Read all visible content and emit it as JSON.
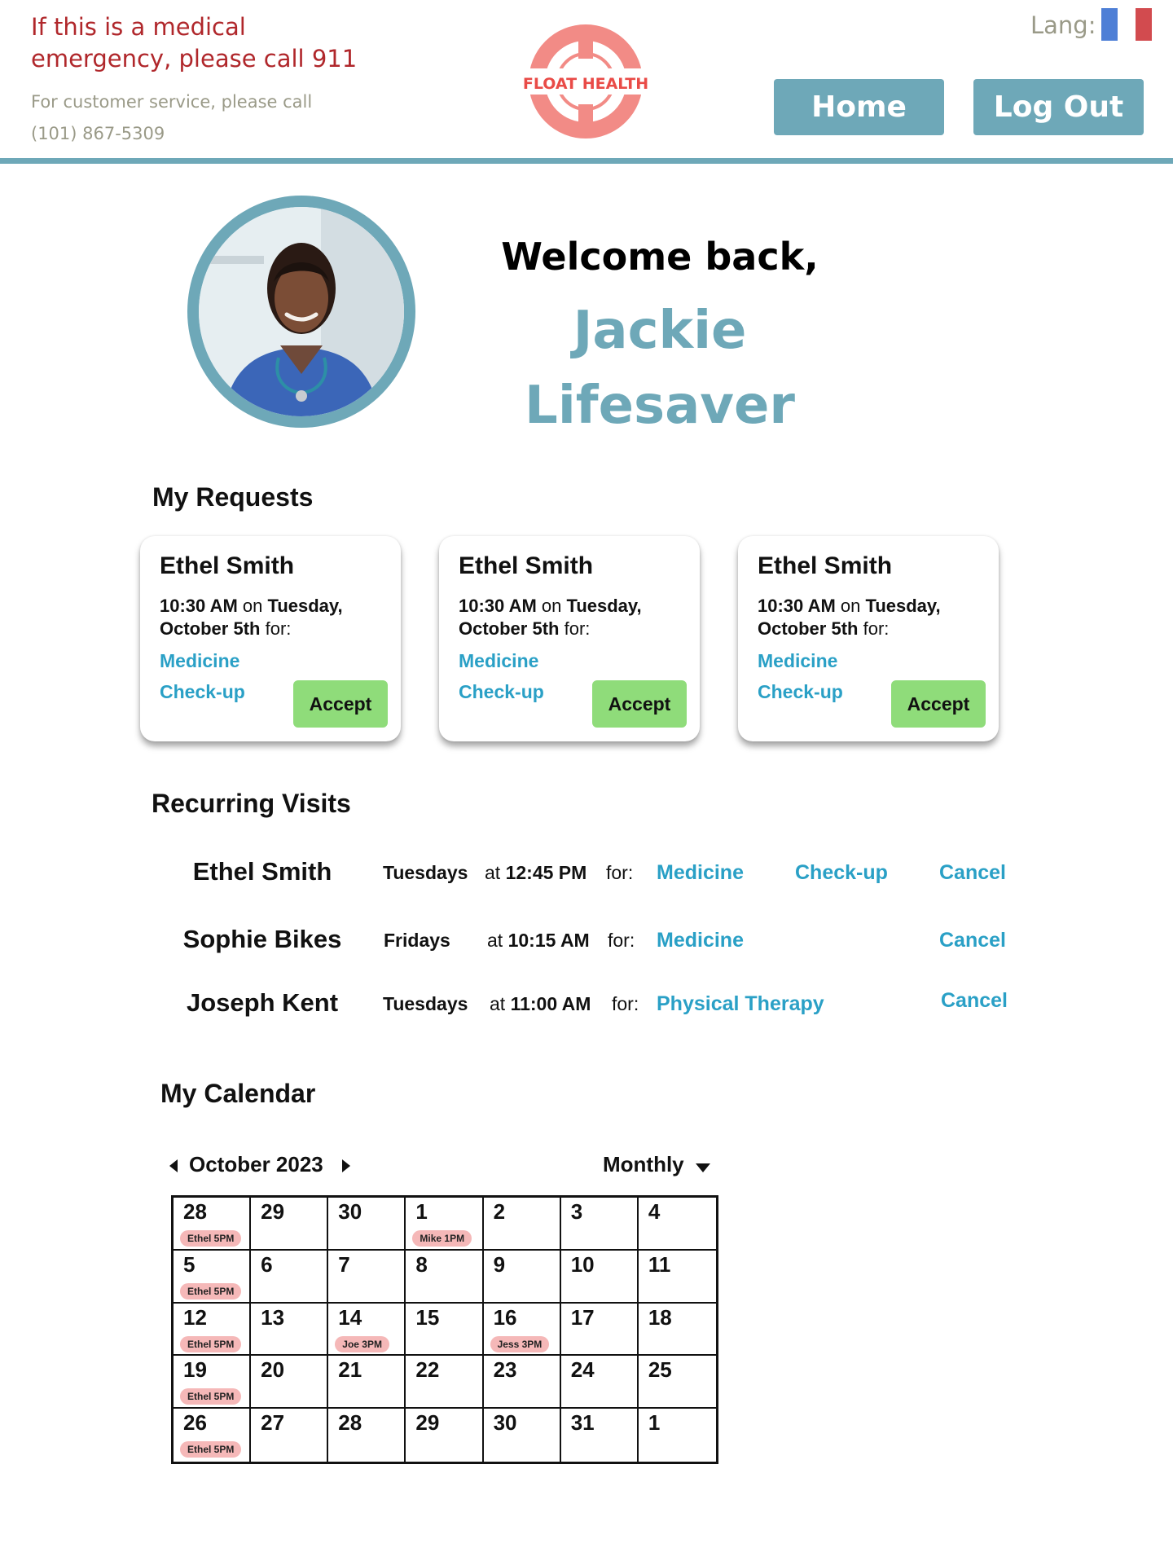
{
  "header": {
    "emergency_text": "If this is a medical emergency, please call 911",
    "service_text": "For customer service, please call (101) 867-5309",
    "logo_text": "FLOAT HEALTH",
    "lang_label": "Lang:",
    "home_label": "Home",
    "logout_label": "Log Out",
    "colors": {
      "accent": "#6ea8b8",
      "emergency": "#b0272b",
      "logo": "#f28b86"
    }
  },
  "profile": {
    "welcome": "Welcome back,",
    "first_name": "Jackie",
    "last_name": "Lifesaver"
  },
  "requests": {
    "title": "My Requests",
    "items": [
      {
        "patient": "Ethel Smith",
        "time": "10:30 AM",
        "on": "on",
        "day": "Tuesday,",
        "date": "October 5th",
        "for": "for:",
        "service1": "Medicine",
        "service2": "Check-up",
        "accept": "Accept"
      },
      {
        "patient": "Ethel Smith",
        "time": "10:30 AM",
        "on": "on",
        "day": "Tuesday,",
        "date": "October 5th",
        "for": "for:",
        "service1": "Medicine",
        "service2": "Check-up",
        "accept": "Accept"
      },
      {
        "patient": "Ethel Smith",
        "time": "10:30 AM",
        "on": "on",
        "day": "Tuesday,",
        "date": "October 5th",
        "for": "for:",
        "service1": "Medicine",
        "service2": "Check-up",
        "accept": "Accept"
      }
    ]
  },
  "recurring": {
    "title": "Recurring Visits",
    "items": [
      {
        "patient": "Ethel Smith",
        "day": "Tuesdays",
        "at": "at",
        "time": "12:45 PM",
        "for": "for:",
        "service1": "Medicine",
        "service2": "Check-up",
        "cancel": "Cancel"
      },
      {
        "patient": "Sophie Bikes",
        "day": "Fridays",
        "at": "at",
        "time": "10:15 AM",
        "for": "for:",
        "service1": "Medicine",
        "service2": "",
        "cancel": "Cancel"
      },
      {
        "patient": "Joseph Kent",
        "day": "Tuesdays",
        "at": "at",
        "time": "11:00 AM",
        "for": "for:",
        "service1": "Physical Therapy",
        "service2": "",
        "cancel": "Cancel"
      }
    ]
  },
  "calendar": {
    "title": "My Calendar",
    "month_label": "October 2023",
    "view_label": "Monthly",
    "event_color": "#f5b8b8",
    "weeks": [
      [
        {
          "day": "28",
          "event": "Ethel 5PM"
        },
        {
          "day": "29",
          "event": ""
        },
        {
          "day": "30",
          "event": ""
        },
        {
          "day": "1",
          "event": "Mike 1PM"
        },
        {
          "day": "2",
          "event": ""
        },
        {
          "day": "3",
          "event": ""
        },
        {
          "day": "4",
          "event": ""
        }
      ],
      [
        {
          "day": "5",
          "event": "Ethel 5PM"
        },
        {
          "day": "6",
          "event": ""
        },
        {
          "day": "7",
          "event": ""
        },
        {
          "day": "8",
          "event": ""
        },
        {
          "day": "9",
          "event": ""
        },
        {
          "day": "10",
          "event": ""
        },
        {
          "day": "11",
          "event": ""
        }
      ],
      [
        {
          "day": "12",
          "event": "Ethel 5PM"
        },
        {
          "day": "13",
          "event": ""
        },
        {
          "day": "14",
          "event": "Joe  3PM"
        },
        {
          "day": "15",
          "event": ""
        },
        {
          "day": "16",
          "event": "Jess  3PM"
        },
        {
          "day": "17",
          "event": ""
        },
        {
          "day": "18",
          "event": ""
        }
      ],
      [
        {
          "day": "19",
          "event": "Ethel 5PM"
        },
        {
          "day": "20",
          "event": ""
        },
        {
          "day": "21",
          "event": ""
        },
        {
          "day": "22",
          "event": ""
        },
        {
          "day": "23",
          "event": ""
        },
        {
          "day": "24",
          "event": ""
        },
        {
          "day": "25",
          "event": ""
        }
      ],
      [
        {
          "day": "26",
          "event": "Ethel 5PM"
        },
        {
          "day": "27",
          "event": ""
        },
        {
          "day": "28",
          "event": ""
        },
        {
          "day": "29",
          "event": ""
        },
        {
          "day": "30",
          "event": ""
        },
        {
          "day": "31",
          "event": ""
        },
        {
          "day": "1",
          "event": ""
        }
      ]
    ]
  }
}
